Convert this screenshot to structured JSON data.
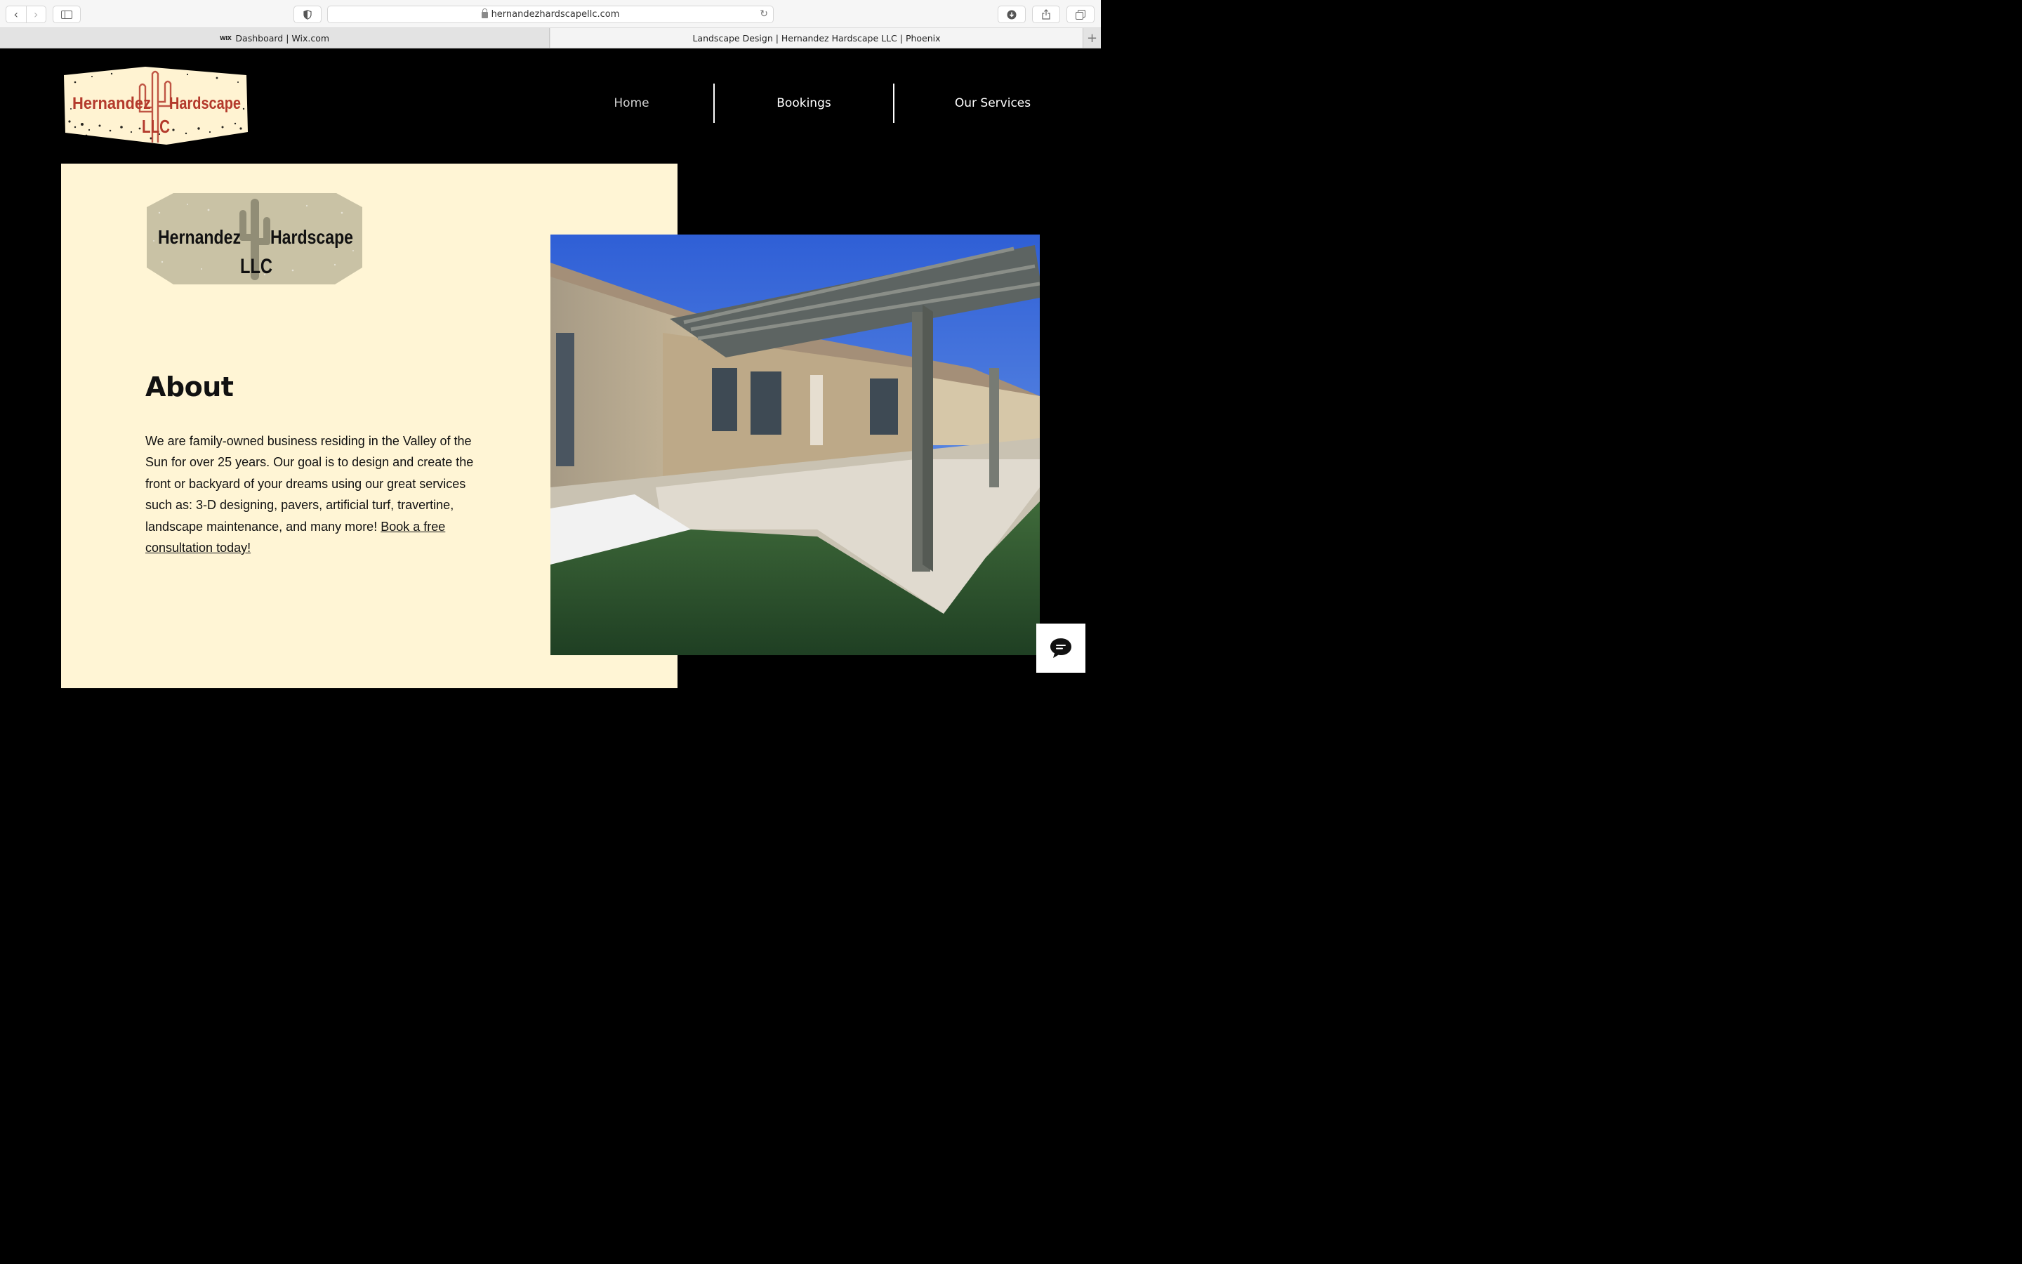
{
  "browser": {
    "url": "hernandezhardscapellc.com",
    "tabs": [
      {
        "label": "Dashboard | Wix.com",
        "favicon": "WIX"
      },
      {
        "label": "Landscape Design | Hernandez Hardscape LLC | Phoenix"
      }
    ],
    "new_tab": "+"
  },
  "site": {
    "logo_top": {
      "word1": "Hernandez",
      "word2": "Hardscape",
      "word3": "LLC"
    },
    "nav": [
      {
        "label": "Home"
      },
      {
        "label": "Bookings"
      },
      {
        "label": "Our Services"
      }
    ],
    "about": {
      "logo": {
        "word1": "Hernandez",
        "word2": "Hardscape",
        "word3": "LLC"
      },
      "title": "About",
      "body": "We are family-owned business residing in the Valley of the Sun for over 25 years. Our goal is to design and create the front or backyard of your dreams using our great services such as: 3-D designing, pavers, artificial turf, travertine, landscape maintenance, and many more!",
      "cta": "Book a free consultation today! "
    }
  },
  "colors": {
    "page_bg": "#000000",
    "panel_bg": "#fff5d5",
    "logo_red": "#b43a2c",
    "logo_cream": "#fff3d2",
    "logo_tan": "#c9c2a5"
  }
}
